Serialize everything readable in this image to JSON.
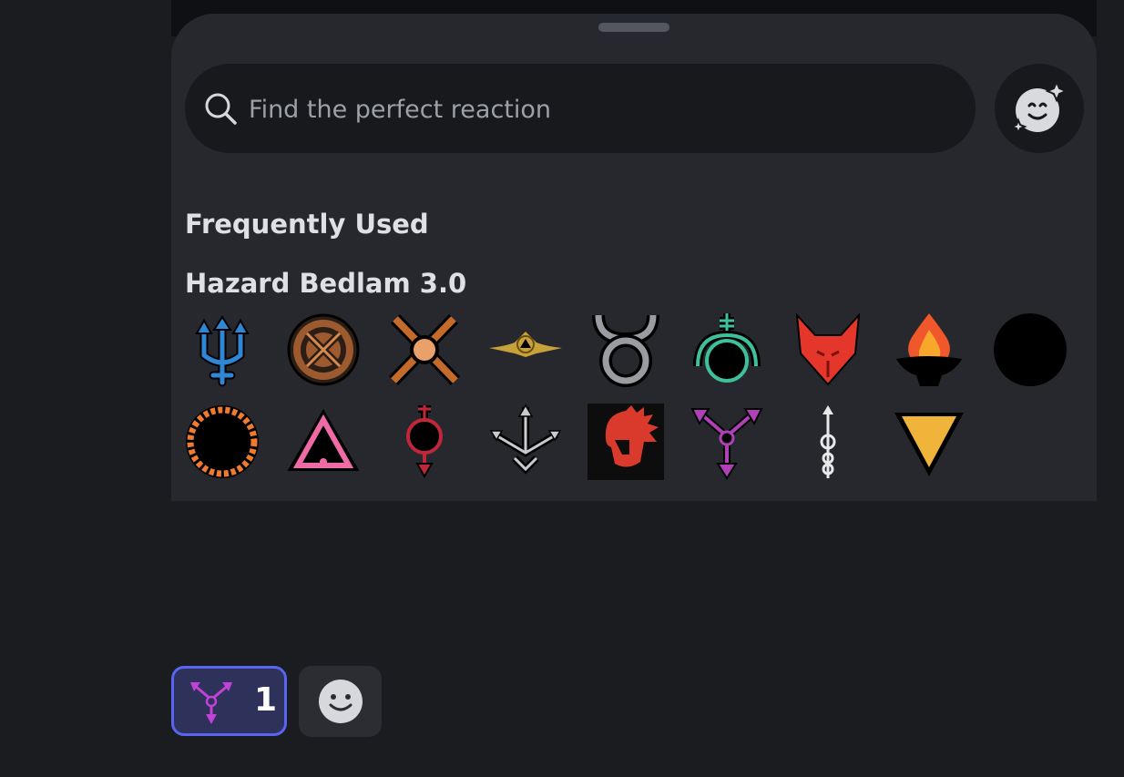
{
  "search": {
    "placeholder": "Find the perfect reaction"
  },
  "sections": {
    "frequent": "Frequently Used",
    "server": "Hazard Bedlam 3.0"
  },
  "emojis": [
    {
      "icon": "blue-trident-icon"
    },
    {
      "icon": "copper-cross-circle-icon"
    },
    {
      "icon": "crossed-swords-icon"
    },
    {
      "icon": "winged-emblem-icon"
    },
    {
      "icon": "horned-circle-icon"
    },
    {
      "icon": "teal-orb-icon"
    },
    {
      "icon": "red-fox-icon"
    },
    {
      "icon": "flame-brazier-icon"
    },
    {
      "icon": "crescent-moon-icon"
    },
    {
      "icon": "sun-gear-icon"
    },
    {
      "icon": "pink-triangle-icon"
    },
    {
      "icon": "red-arrow-orb-icon"
    },
    {
      "icon": "silver-arrows-icon"
    },
    {
      "icon": "spartan-helmet-icon"
    },
    {
      "icon": "purple-three-arrows-icon"
    },
    {
      "icon": "caduceus-icon"
    },
    {
      "icon": "yellow-triangle-icon"
    }
  ],
  "reaction": {
    "count": "1",
    "icon": "purple-three-arrows-icon",
    "accent": "#5865f2"
  }
}
